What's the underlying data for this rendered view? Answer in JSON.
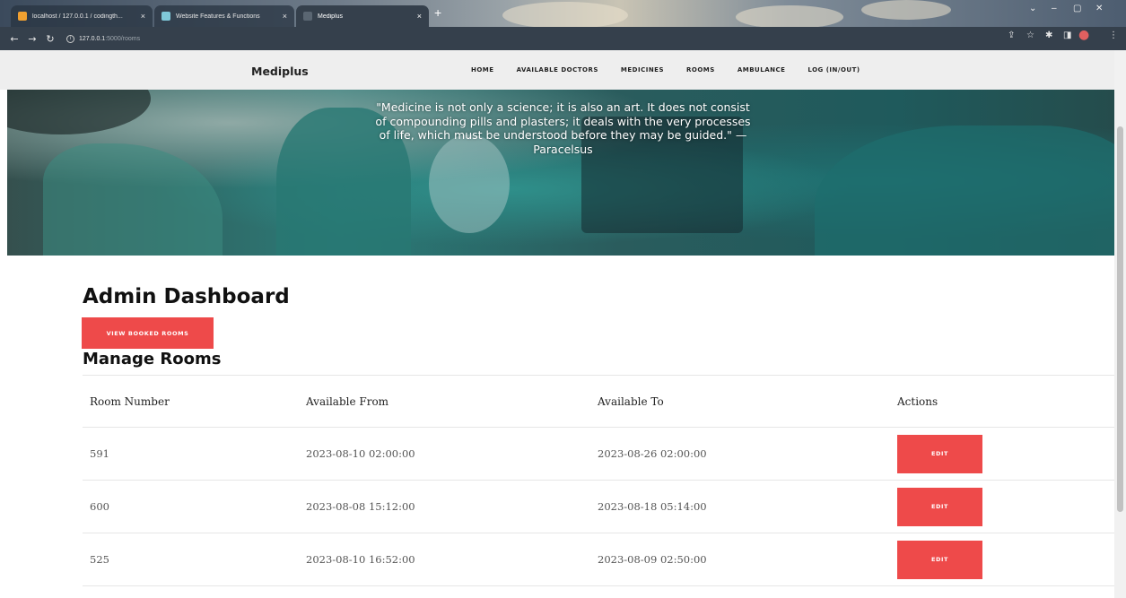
{
  "browser": {
    "tabs": [
      {
        "title": "localhost / 127.0.0.1 / codingth...",
        "close": "×"
      },
      {
        "title": "Website Features & Functions",
        "close": "×"
      },
      {
        "title": "Mediplus",
        "close": "×"
      }
    ],
    "new_tab": "+",
    "url_host": "127.0.0.1",
    "url_path": ":5000/rooms"
  },
  "navbar": {
    "brand": "Mediplus",
    "items": [
      "HOME",
      "AVAILABLE DOCTORS",
      "MEDICINES",
      "ROOMS",
      "AMBULANCE",
      "LOG (IN/OUT)"
    ]
  },
  "hero": {
    "quote_lines": [
      "\"Medicine is not only a science; it is also an art. It does not consist",
      "of compounding pills and plasters; it deals with the very processes",
      "of life, which must be understood before they may be guided.\" —",
      "Paracelsus"
    ]
  },
  "dashboard": {
    "title": "Admin Dashboard",
    "booked_button": "VIEW BOOKED ROOMS",
    "section_title": "Manage Rooms"
  },
  "table": {
    "headers": [
      "Room Number",
      "Available From",
      "Available To",
      "Actions"
    ],
    "rows": [
      {
        "room": "591",
        "from": "2023-08-10 02:00:00",
        "to": "2023-08-26 02:00:00",
        "action": "EDIT"
      },
      {
        "room": "600",
        "from": "2023-08-08 15:12:00",
        "to": "2023-08-18 05:14:00",
        "action": "EDIT"
      },
      {
        "room": "525",
        "from": "2023-08-10 16:52:00",
        "to": "2023-08-09 02:50:00",
        "action": "EDIT"
      }
    ]
  },
  "colors": {
    "accent": "#ee4a4a",
    "nav_bg": "#ececec"
  }
}
